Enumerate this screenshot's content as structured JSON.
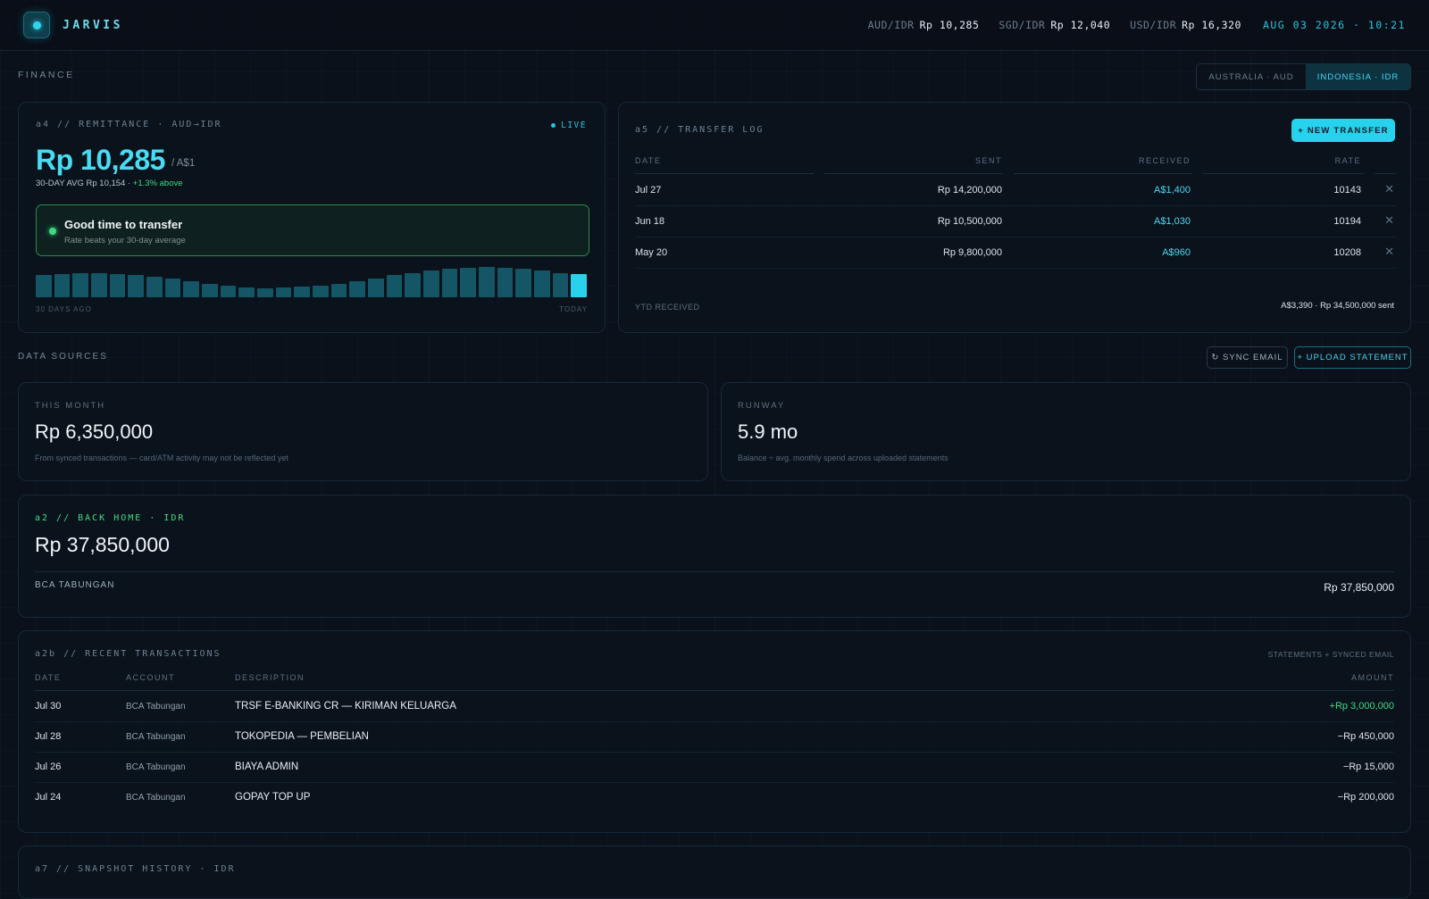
{
  "topbar": {
    "brand": "JARVIS",
    "rates": [
      {
        "label": "AUD/IDR",
        "value": "Rp 10,285"
      },
      {
        "label": "SGD/IDR",
        "value": "Rp 12,040"
      },
      {
        "label": "USD/IDR",
        "value": "Rp 16,320"
      }
    ],
    "datetime": "AUG 03 2026 · 10:21"
  },
  "finance": {
    "label": "FINANCE",
    "region_options": [
      "AUSTRALIA · AUD",
      "INDONESIA · IDR"
    ],
    "selected_region": "INDONESIA · IDR"
  },
  "remittance": {
    "title": "a4 // REMITTANCE · AUD→IDR",
    "live": "LIVE",
    "rate": "Rp 10,285",
    "per": "/ A$1",
    "avg_text": "30-DAY AVG Rp 10,154 ·",
    "avg_delta": "+1.3% above",
    "signal_title": "Good time to transfer",
    "signal_sub": "Rate beats your 30-day average",
    "history_start_label": "30 DAYS AGO",
    "history_end_label": "TODAY",
    "history_levels": [
      0.86,
      0.9,
      0.93,
      0.93,
      0.9,
      0.86,
      0.8,
      0.72,
      0.62,
      0.52,
      0.44,
      0.38,
      0.36,
      0.38,
      0.42,
      0.46,
      0.52,
      0.62,
      0.74,
      0.86,
      0.96,
      1.05,
      1.12,
      1.16,
      1.19,
      1.16,
      1.12,
      1.05,
      0.96,
      0.9
    ]
  },
  "transfer_log": {
    "title": "a5 // TRANSFER LOG",
    "new_button": "+ NEW TRANSFER",
    "columns": [
      "DATE",
      "SENT",
      "RECEIVED",
      "RATE"
    ],
    "rows": [
      {
        "date": "Jul 27",
        "sent": "Rp 14,200,000",
        "received": "A$1,400",
        "rate": "10143"
      },
      {
        "date": "Jun 18",
        "sent": "Rp 10,500,000",
        "received": "A$1,030",
        "rate": "10194"
      },
      {
        "date": "May 20",
        "sent": "Rp 9,800,000",
        "received": "A$960",
        "rate": "10208"
      }
    ],
    "remove_glyph": "✕",
    "ytd_label": "YTD RECEIVED",
    "ytd_value": "A$3,390 · Rp 34,500,000 sent"
  },
  "data_sources": {
    "label": "DATA SOURCES",
    "sync_button": "↻ SYNC EMAIL",
    "upload_button": "+ UPLOAD STATEMENT"
  },
  "this_month": {
    "label": "THIS MONTH",
    "value": "Rp 6,350,000",
    "note": "From synced transactions — card/ATM activity may not be reflected yet"
  },
  "runway": {
    "label": "RUNWAY",
    "value": "5.9 mo",
    "note": "Balance ÷ avg. monthly spend across uploaded statements"
  },
  "back_home": {
    "title": "a2 // BACK HOME · IDR",
    "total": "Rp 37,850,000",
    "account_name": "BCA TABUNGAN",
    "account_value": "Rp 37,850,000"
  },
  "recent_transactions": {
    "title": "a2b // RECENT TRANSACTIONS",
    "source": "STATEMENTS + SYNCED EMAIL",
    "columns": [
      "DATE",
      "ACCOUNT",
      "DESCRIPTION",
      "AMOUNT"
    ],
    "rows": [
      {
        "date": "Jul 30",
        "account": "BCA Tabungan",
        "description": "TRSF E-BANKING CR — KIRIMAN KELUARGA",
        "amount": "+Rp 3,000,000"
      },
      {
        "date": "Jul 28",
        "account": "BCA Tabungan",
        "description": "TOKOPEDIA — PEMBELIAN",
        "amount": "−Rp 450,000"
      },
      {
        "date": "Jul 26",
        "account": "BCA Tabungan",
        "description": "BIAYA ADMIN",
        "amount": "−Rp 15,000"
      },
      {
        "date": "Jul 24",
        "account": "BCA Tabungan",
        "description": "GOPAY TOP UP",
        "amount": "−Rp 200,000"
      }
    ]
  },
  "snapshot_history": {
    "title": "a7 // SNAPSHOT HISTORY · IDR"
  },
  "colors": {
    "accent": "#29c4de",
    "positive": "#3ddc84",
    "background": "#0a111a"
  }
}
